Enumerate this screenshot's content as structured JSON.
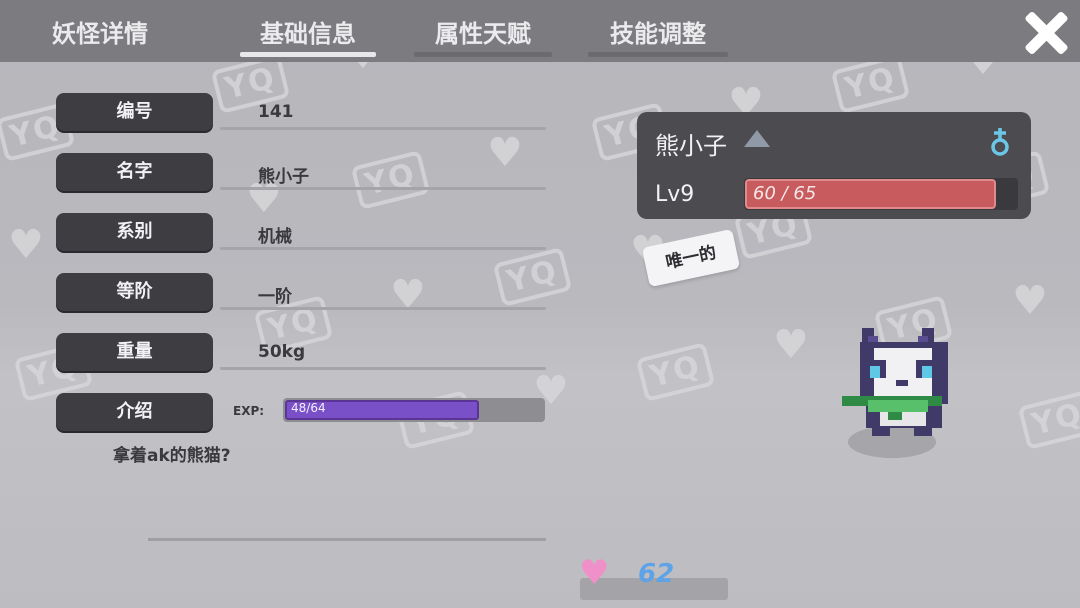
{
  "tabs": [
    {
      "label": "妖怪详情"
    },
    {
      "label": "基础信息"
    },
    {
      "label": "属性天赋"
    },
    {
      "label": "技能调整"
    }
  ],
  "info": {
    "number_label": "编号",
    "number_value": "141",
    "name_label": "名字",
    "name_value": "熊小子",
    "type_label": "系别",
    "type_value": "机械",
    "rank_label": "等阶",
    "rank_value": "一阶",
    "weight_label": "重量",
    "weight_value": "50kg",
    "intro_label": "介绍",
    "exp_label": "EXP:",
    "exp_text": "48/64",
    "exp_fraction": 0.75,
    "description": "拿着ak的熊猫?"
  },
  "monster": {
    "name": "熊小子",
    "level": "Lv9",
    "hp_text": "60 / 65",
    "hp_fraction": 0.923,
    "tag": "唯一的",
    "rank_icon": "triangle-up-icon",
    "gender_icon": "female-icon"
  },
  "footer": {
    "heart_count": "62",
    "heart_icon": "heart-icon"
  },
  "watermark": {
    "text": "YQ"
  },
  "colors": {
    "hp_fill": "#c85b5e",
    "exp_fill": "#7a50c8",
    "heart": "#f090c8",
    "heart_count": "#5ea2e8",
    "gender": "#6cc6e8"
  }
}
